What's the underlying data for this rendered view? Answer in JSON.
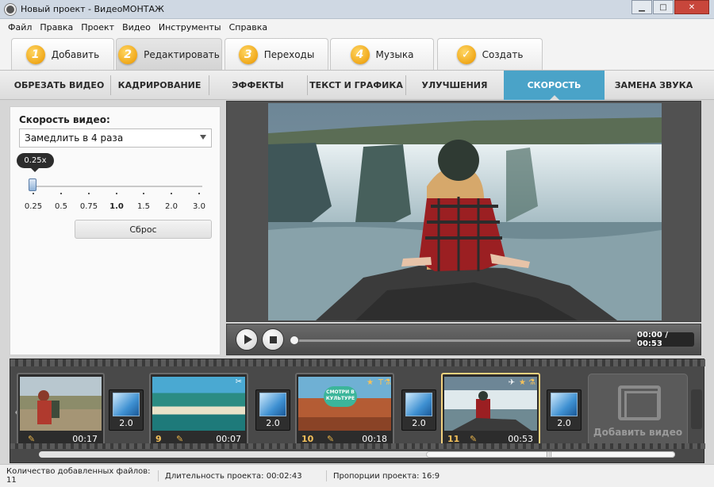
{
  "window": {
    "title": "Новый проект - ВидеоМОНТАЖ",
    "minimize": "▁",
    "maximize": "□",
    "close": "✕"
  },
  "menu": [
    "Файл",
    "Правка",
    "Проект",
    "Видео",
    "Инструменты",
    "Справка"
  ],
  "steps": [
    {
      "num": "1",
      "label": "Добавить"
    },
    {
      "num": "2",
      "label": "Редактировать"
    },
    {
      "num": "3",
      "label": "Переходы"
    },
    {
      "num": "4",
      "label": "Музыка"
    },
    {
      "num": "✓",
      "label": "Создать"
    }
  ],
  "tabs": [
    "ОБРЕЗАТЬ ВИДЕО",
    "КАДРИРОВАНИЕ",
    "ЭФФЕКТЫ",
    "ТЕКСТ И ГРАФИКА",
    "УЛУЧШЕНИЯ",
    "СКОРОСТЬ",
    "ЗАМЕНА ЗВУКА"
  ],
  "speed_panel": {
    "label": "Скорость видео:",
    "selected": "Замедлить в 4 раза",
    "slider_value": "0.25x",
    "ticks": [
      "0.25",
      "0.5",
      "0.75",
      "1.0",
      "1.5",
      "2.0",
      "3.0"
    ],
    "reset": "Сброс"
  },
  "player": {
    "time": "00:00 / 00:53",
    "progress": 0
  },
  "timeline": {
    "clips": [
      {
        "num": "",
        "time": "00:17"
      },
      {
        "num": "9",
        "time": "00:07"
      },
      {
        "num": "10",
        "time": "00:18"
      },
      {
        "num": "11",
        "time": "00:53"
      }
    ],
    "transitions": [
      "2.0",
      "2.0",
      "2.0",
      "2.0"
    ],
    "sticker_text": "СМОТРИ В КУЛЬТУРЕ",
    "add_video": "Добавить видео",
    "scroll_mark": "|||"
  },
  "status": {
    "files": "Количество добавленных файлов: 11",
    "duration": "Длительность проекта:   00:02:43",
    "ratio": "Пропорции проекта:   16:9"
  },
  "colors": {
    "accent": "#4aa3c8",
    "step_badge": "#f0a81a",
    "selected_clip": "#f3d27e"
  }
}
